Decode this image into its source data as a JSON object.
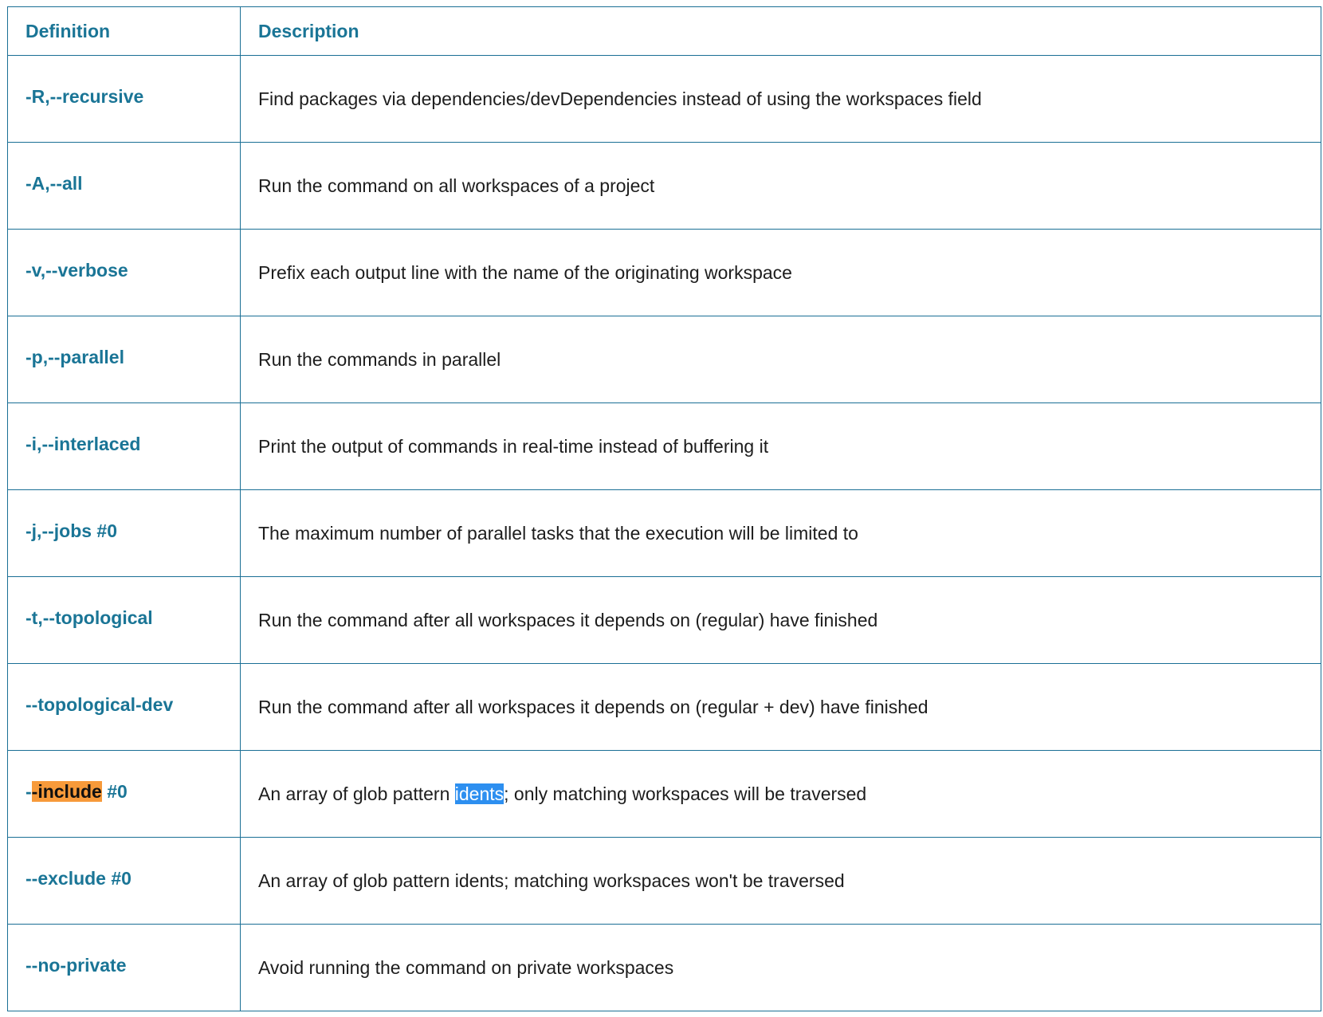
{
  "table": {
    "headers": {
      "definition": "Definition",
      "description": "Description"
    },
    "rows": [
      {
        "definition": "-R,--recursive",
        "description": "Find packages via dependencies/devDependencies instead of using the workspaces field"
      },
      {
        "definition": "-A,--all",
        "description": "Run the command on all workspaces of a project"
      },
      {
        "definition": "-v,--verbose",
        "description": "Prefix each output line with the name of the originating workspace"
      },
      {
        "definition": "-p,--parallel",
        "description": "Run the commands in parallel"
      },
      {
        "definition": "-i,--interlaced",
        "description": "Print the output of commands in real-time instead of buffering it"
      },
      {
        "definition": "-j,--jobs #0",
        "description": "The maximum number of parallel tasks that the execution will be limited to"
      },
      {
        "definition": "-t,--topological",
        "description": "Run the command after all workspaces it depends on (regular) have finished"
      },
      {
        "definition": "--topological-dev",
        "description": "Run the command after all workspaces it depends on (regular + dev) have finished"
      },
      {
        "definition": "--include #0",
        "definition_parts": {
          "pre": "-",
          "highlight": "-include",
          "post": " #0"
        },
        "description": "An array of glob pattern idents; only matching workspaces will be traversed",
        "description_parts": {
          "pre": "An array of glob pattern ",
          "selected": "idents",
          "post": "; only matching workspaces will be traversed"
        }
      },
      {
        "definition": "--exclude #0",
        "description": "An array of glob pattern idents; matching workspaces won't be traversed"
      },
      {
        "definition": "--no-private",
        "description": "Avoid running the command on private workspaces"
      }
    ]
  },
  "colors": {
    "accent": "#1a7596",
    "border": "#1a6f95",
    "text": "#1d1d1d",
    "search_highlight": "#f79a3a",
    "selection_highlight": "#2d8ff0"
  }
}
